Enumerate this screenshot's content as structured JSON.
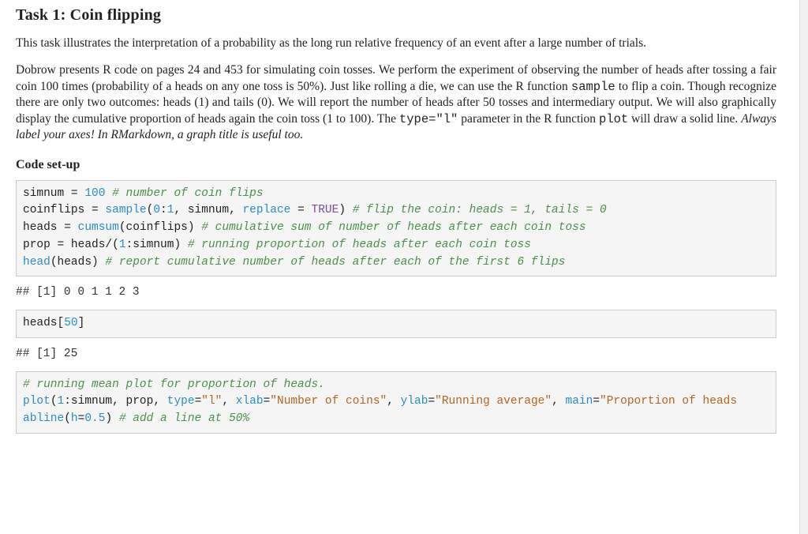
{
  "doc": {
    "title": "Task 1: Coin flipping",
    "para1": "This task illustrates the interpretation of a probability as the long run relative frequency of an event after a large number of trials.",
    "para2": {
      "seg1": "Dobrow presents R code on pages 24 and 453 for simulating coin tosses. We perform the experiment of observing the number of heads after tossing a fair coin 100 times (probability of a heads on any one toss is 50%). Just like rolling a die, we can use the R function ",
      "tt1": "sample",
      "seg2": " to flip a coin. Though recognize there are only two outcomes: heads (1) and tails (0). We will report the number of heads after 50 tosses and intermediary output. We will also graphically display the cumulative proportion of heads again the coin toss (1 to 100). The ",
      "tt2": "type=\"l\"",
      "seg3": " parameter in the R function ",
      "tt3": "plot",
      "seg4": " will draw a solid line. ",
      "it1": "Always label your axes! In RMarkdown, a graph title is useful too."
    },
    "subhead": "Code set-up",
    "code1": {
      "l1": {
        "a": "simnum = ",
        "num": "100",
        "cmt": " # number of coin flips"
      },
      "l2": {
        "a": "coinflips = ",
        "fn": "sample",
        "b": "(",
        "arg1": "0",
        "c": ":",
        "arg2": "1",
        "d": ", simnum, ",
        "kw": "replace",
        "e": " = ",
        "bool": "TRUE",
        "f": ")",
        "cmt": " # flip the coin: heads = 1, tails = 0"
      },
      "l3": {
        "a": "heads = ",
        "fn": "cumsum",
        "b": "(coinflips)",
        "cmt": " # cumulative sum of number of heads after each coin toss"
      },
      "l4": {
        "a": "prop = heads/(",
        "num": "1",
        "b": ":simnum)",
        "cmt": " # running proportion of heads after each coin toss"
      },
      "l5": {
        "fn": "head",
        "a": "(heads)",
        "cmt": " # report cumulative number of heads after each of the first 6 flips"
      }
    },
    "out1": "## [1] 0 0 1 1 2 3",
    "code2": {
      "a": "heads[",
      "num": "50",
      "b": "]"
    },
    "out2": "## [1] 25",
    "code3": {
      "l1": {
        "cmt": "# running mean plot for proportion of heads."
      },
      "l2": {
        "fn": "plot",
        "a": "(",
        "num": "1",
        "b": ":simnum, prop, ",
        "kw1": "type",
        "c": "=",
        "s1": "\"l\"",
        "d": ", ",
        "kw2": "xlab",
        "e": "=",
        "s2": "\"Number of coins\"",
        "f": ", ",
        "kw3": "ylab",
        "g": "=",
        "s3": "\"Running average\"",
        "h": ", ",
        "kw4": "main",
        "i": "=",
        "s4": "\"Proportion of heads"
      },
      "l3": {
        "fn": "abline",
        "a": "(",
        "kw": "h",
        "b": "=",
        "num": "0.5",
        "c": ")",
        "cmt": " # add a line at 50%"
      }
    }
  }
}
